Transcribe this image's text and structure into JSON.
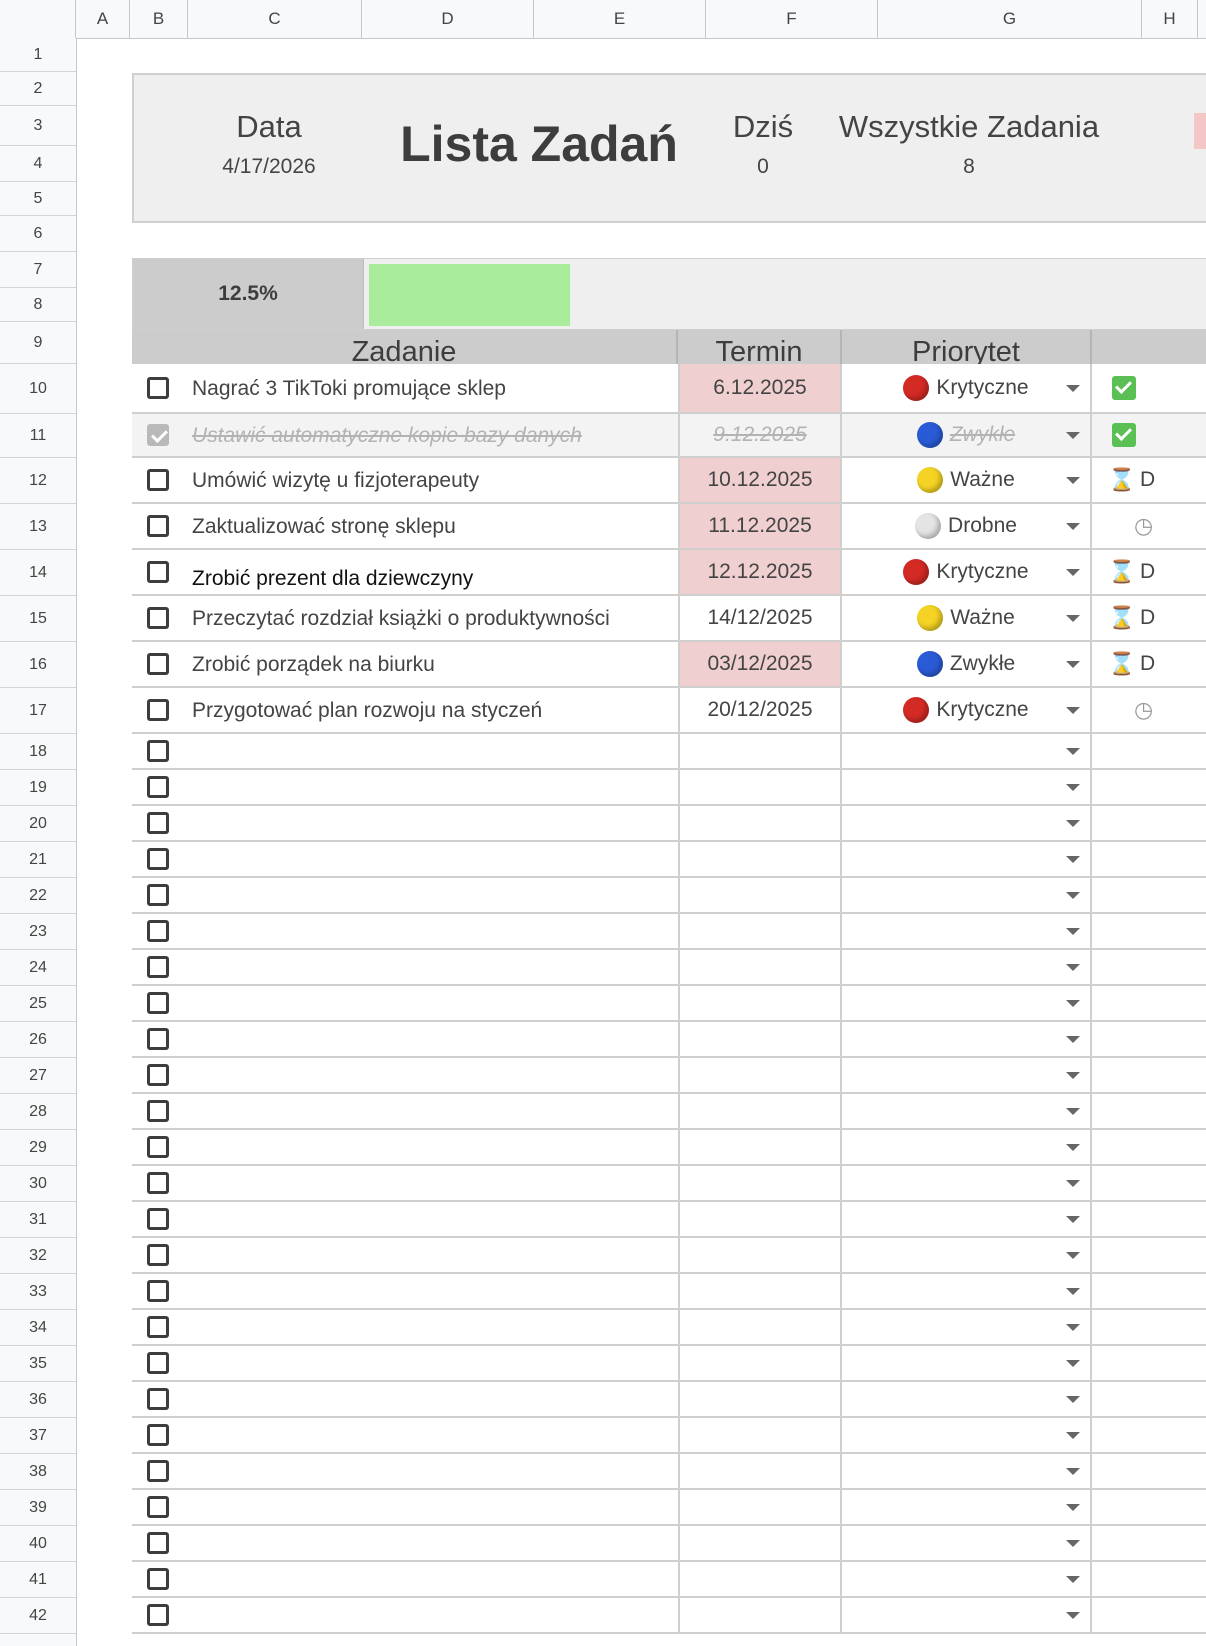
{
  "columns": [
    "A",
    "B",
    "C",
    "D",
    "E",
    "F",
    "G",
    "H"
  ],
  "rows": [
    "1",
    "2",
    "3",
    "4",
    "5",
    "6",
    "7",
    "8",
    "9",
    "10",
    "11",
    "12",
    "13",
    "14",
    "15",
    "16",
    "17",
    "18",
    "19",
    "20",
    "21",
    "22",
    "23",
    "24",
    "25",
    "26",
    "27",
    "28",
    "29",
    "30",
    "31",
    "32",
    "33",
    "34",
    "35",
    "36",
    "37",
    "38",
    "39",
    "40",
    "41",
    "42"
  ],
  "header": {
    "date_label": "Data",
    "date_value": "4/17/2026",
    "title": "Lista Zadań",
    "today_label": "Dziś",
    "today_value": "0",
    "all_label": "Wszystkie Zadania",
    "all_value": "8"
  },
  "progress": {
    "percent_label": "12.5%",
    "fill_fraction": 0.125
  },
  "table_header": {
    "task": "Zadanie",
    "due": "Termin",
    "priority": "Priorytet"
  },
  "tasks": [
    {
      "checked": false,
      "name": "Nagrać 3 TikToki promujące sklep",
      "due": "6.12.2025",
      "overdue": true,
      "priority": "Krytyczne",
      "dot": "#d42a24",
      "status_icon": "check",
      "status_text": ""
    },
    {
      "checked": true,
      "name": "Ustawić automatyczne kopie bazy danych",
      "due": "9.12.2025",
      "overdue": false,
      "priority": "Zwykłe",
      "dot": "#2a5bd7",
      "status_icon": "check",
      "status_text": ""
    },
    {
      "checked": false,
      "name": "Umówić wizytę u fizjoterapeuty",
      "due": "10.12.2025",
      "overdue": true,
      "priority": "Ważne",
      "dot": "#f4d324",
      "status_icon": "hourglass",
      "status_text": "D"
    },
    {
      "checked": false,
      "name": "Zaktualizować stronę sklepu",
      "due": "11.12.2025",
      "overdue": true,
      "priority": "Drobne",
      "dot": "#e4e4e4",
      "status_icon": "clock",
      "status_text": ""
    },
    {
      "checked": false,
      "name": "Zrobić prezent dla dziewczyny",
      "due": "12.12.2025",
      "overdue": true,
      "priority": "Krytyczne",
      "dot": "#d42a24",
      "status_icon": "hourglass",
      "status_text": "D"
    },
    {
      "checked": false,
      "name": "Przeczytać rozdział książki o produktywności",
      "due": "14/12/2025",
      "overdue": false,
      "priority": "Ważne",
      "dot": "#f4d324",
      "status_icon": "hourglass",
      "status_text": "D"
    },
    {
      "checked": false,
      "name": "Zrobić porządek na biurku",
      "due": "03/12/2025",
      "overdue": true,
      "priority": "Zwykłe",
      "dot": "#2a5bd7",
      "status_icon": "hourglass",
      "status_text": "D"
    },
    {
      "checked": false,
      "name": "Przygotować plan rozwoju na styczeń",
      "due": "20/12/2025",
      "overdue": false,
      "priority": "Krytyczne",
      "dot": "#d42a24",
      "status_icon": "clock",
      "status_text": ""
    }
  ],
  "empty_rows": 25
}
